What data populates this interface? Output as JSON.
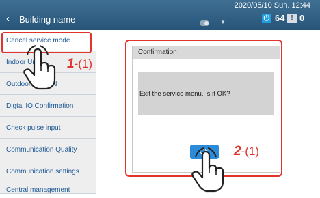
{
  "header": {
    "back_icon": "chevron-left-icon",
    "title": "Building name",
    "datetime": "2020/05/10 Sun. 12:44",
    "power_count": "64",
    "warning_count": "0",
    "power_icon_glyph": "⏻",
    "warning_icon_glyph": "!",
    "back_glyph": "‹"
  },
  "sidebar": {
    "items": [
      {
        "label": "Cancel service mode"
      },
      {
        "label": "Indoor Unit"
      },
      {
        "label": "Outdoor Unit ON"
      },
      {
        "label": "Digtal IO Confirmation"
      },
      {
        "label": "Check pulse input"
      },
      {
        "label": "Communication Quality"
      },
      {
        "label": "Communication settings"
      },
      {
        "label": "Central management"
      }
    ]
  },
  "dialog": {
    "title": "Confirmation",
    "message": "Exit the service menu. Is it OK?",
    "ok_label": "OK"
  },
  "annotations": {
    "step1_num": "1",
    "step1_sub": "-(1)",
    "step2_num": "2",
    "step2_sub": "-(1)"
  },
  "colors": {
    "header": "#2f5f85",
    "highlight": "#e0342d",
    "menu_text": "#1f5a96",
    "ok_button": "#2b8bd8"
  }
}
